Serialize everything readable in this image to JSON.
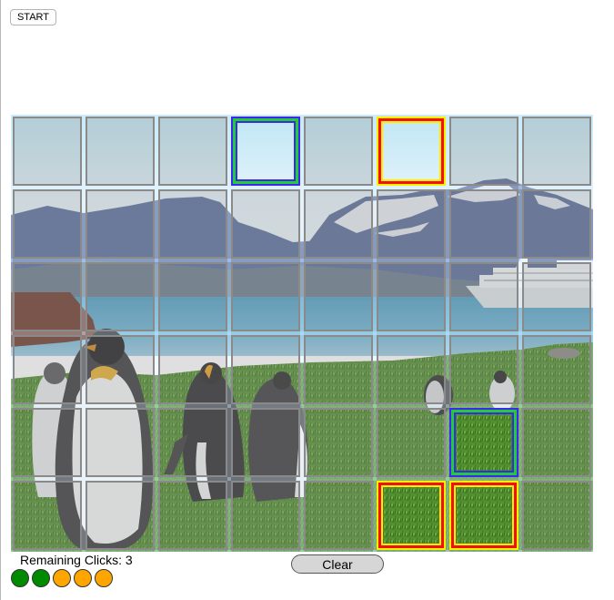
{
  "toolbar": {
    "start_label": "START"
  },
  "captcha": {
    "image_description": "Penguins on grass with mountains, sea and a cruise ship",
    "columns": 8,
    "rows": 6,
    "selected_cells": [
      {
        "row": 0,
        "col": 3,
        "state": "green"
      },
      {
        "row": 0,
        "col": 5,
        "state": "red"
      },
      {
        "row": 4,
        "col": 6,
        "state": "green"
      },
      {
        "row": 5,
        "col": 5,
        "state": "red"
      },
      {
        "row": 5,
        "col": 6,
        "state": "red"
      }
    ],
    "selection_colors": {
      "green": {
        "outer": "#3c28f0",
        "middle": "#22cc33"
      },
      "red": {
        "outer": "#ffee00",
        "middle": "#ee1111"
      }
    }
  },
  "status": {
    "remaining_label": "Remaining Clicks: 3",
    "remaining_clicks": 3,
    "indicators": [
      {
        "state": "used",
        "color": "#008a00"
      },
      {
        "state": "used",
        "color": "#008a00"
      },
      {
        "state": "available",
        "color": "#ffa500"
      },
      {
        "state": "available",
        "color": "#ffa500"
      },
      {
        "state": "available",
        "color": "#ffa500"
      }
    ]
  },
  "controls": {
    "clear_label": "Clear"
  }
}
